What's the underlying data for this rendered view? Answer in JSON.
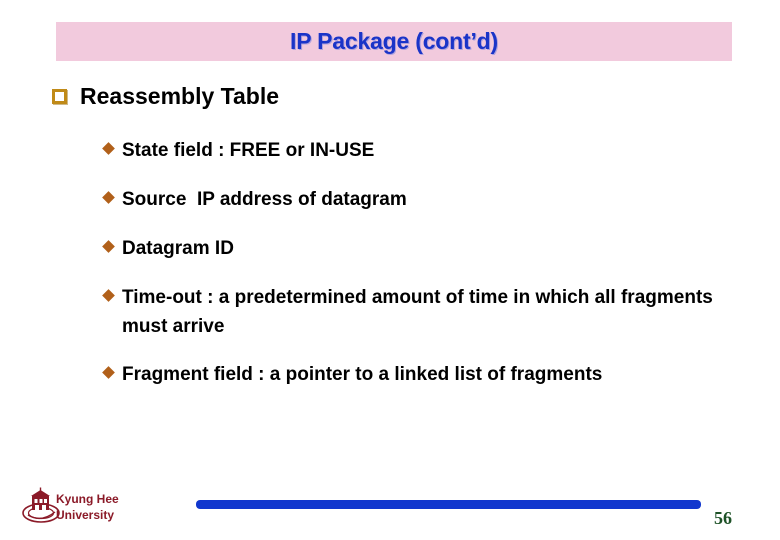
{
  "slide": {
    "background_color": "#ffffff",
    "title": {
      "text": "IP Package (cont’d)",
      "banner_color": "#f2cadd",
      "text_color": "#1a34c8"
    },
    "heading": {
      "text": "Reassembly Table",
      "bullet_icon": "hollow-square-bullet-icon",
      "bullet_color": "#c08a18"
    },
    "bullets": [
      {
        "text": "State field : FREE or IN-USE",
        "icon": "diamond-bullet-icon"
      },
      {
        "text": "Source  IP address of datagram",
        "icon": "diamond-bullet-icon"
      },
      {
        "text": "Datagram ID",
        "icon": "diamond-bullet-icon"
      },
      {
        "text": "Time-out : a predetermined amount of time in which all fragments must arrive",
        "icon": "diamond-bullet-icon"
      },
      {
        "text": "Fragment field : a pointer to a linked list of fragments",
        "icon": "diamond-bullet-icon"
      }
    ],
    "bullet_color": "#b1601a",
    "footer": {
      "organization": "Kyung Hee\nUniversity",
      "organization_color": "#8b1a28",
      "logo_icon": "kyung-hee-university-crest-icon",
      "bar_color": "#1137ce",
      "page_number": "56",
      "page_number_color": "#1e5227"
    }
  }
}
